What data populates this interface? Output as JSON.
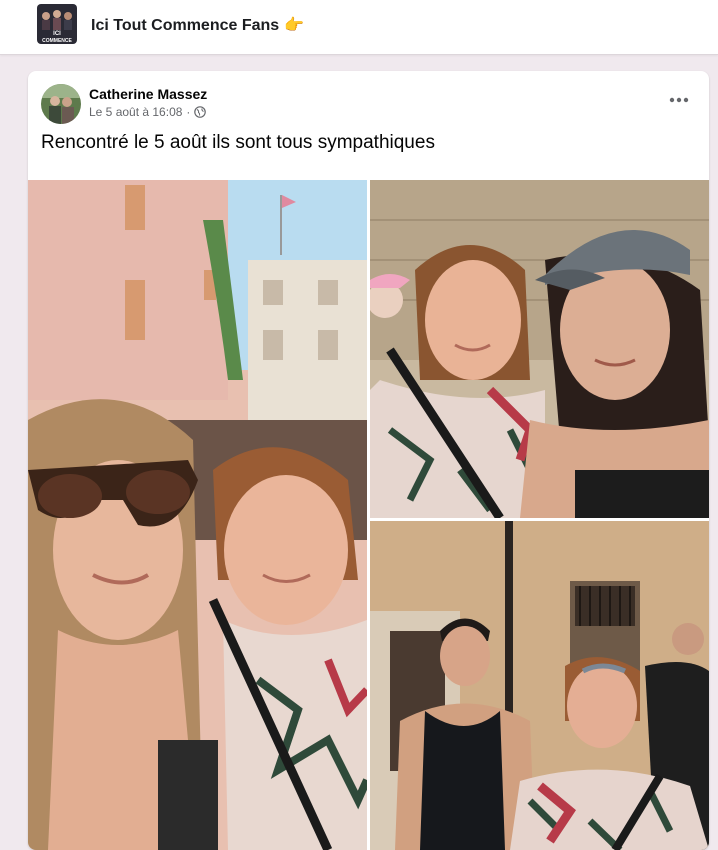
{
  "group": {
    "title": "Ici Tout Commence Fans",
    "emoji": "👉",
    "avatar_text_top": "ICI",
    "avatar_text_bottom": "COMMENCE"
  },
  "post": {
    "author": "Catherine Massez",
    "date": "Le 5 août à 16:08",
    "separator": "·",
    "privacy_icon": "globe-icon",
    "more_icon": "more-options-icon",
    "text": "Rencontré le 5 août ils sont tous sympathiques",
    "photos": [
      {
        "name": "photo-selfie-sunglasses"
      },
      {
        "name": "photo-selfie-cap"
      },
      {
        "name": "photo-man-tank-top"
      }
    ]
  }
}
